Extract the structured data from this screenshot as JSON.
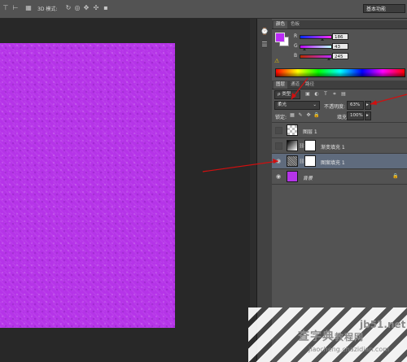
{
  "options_bar": {
    "mode_label": "3D 模式:",
    "workspace": "基本功能"
  },
  "color_panel": {
    "tabs": [
      "颜色",
      "色板"
    ],
    "foreground": "#ba2bf5",
    "background": "#ffffff",
    "channels": [
      {
        "label": "R",
        "value": "186",
        "fraction": 0.73,
        "gradient": "linear-gradient(to right,#002bf5,#ff2bf5)"
      },
      {
        "label": "G",
        "value": "43",
        "fraction": 0.17,
        "gradient": "linear-gradient(to right,#ba00f5,#baff f5)"
      },
      {
        "label": "B",
        "value": "245",
        "fraction": 0.96,
        "gradient": "linear-gradient(to right,#ba2b00,#ba2bff)"
      }
    ]
  },
  "layers_panel": {
    "tabs": [
      "图层",
      "通道",
      "路径"
    ],
    "filter_kind": "类型",
    "blend_mode": "柔光",
    "opacity_label": "不透明度:",
    "opacity_value": "63%",
    "lock_label": "锁定:",
    "fill_label": "填充:",
    "fill_value": "100%",
    "layers": [
      {
        "name": "图层 1",
        "visible": false,
        "selected": false,
        "thumb": "transparent",
        "has_mask": false
      },
      {
        "name": "渐变填充 1",
        "visible": false,
        "selected": false,
        "thumb": "gradient",
        "has_mask": true
      },
      {
        "name": "图案填充 1",
        "visible": true,
        "selected": true,
        "thumb": "pattern",
        "has_mask": true
      },
      {
        "name": "背景",
        "visible": true,
        "selected": false,
        "thumb": "purple",
        "has_mask": false,
        "locked": true
      }
    ]
  },
  "watermark": {
    "line1": "查字典",
    "line1b": "教程网",
    "site": "jb51.net",
    "url": "jiaocheng.chazidian.com"
  },
  "colors": {
    "canvas_fill": "#b534e8",
    "selected_row": "#5f6b7d",
    "annotation_arrow": "#d10f0f"
  }
}
